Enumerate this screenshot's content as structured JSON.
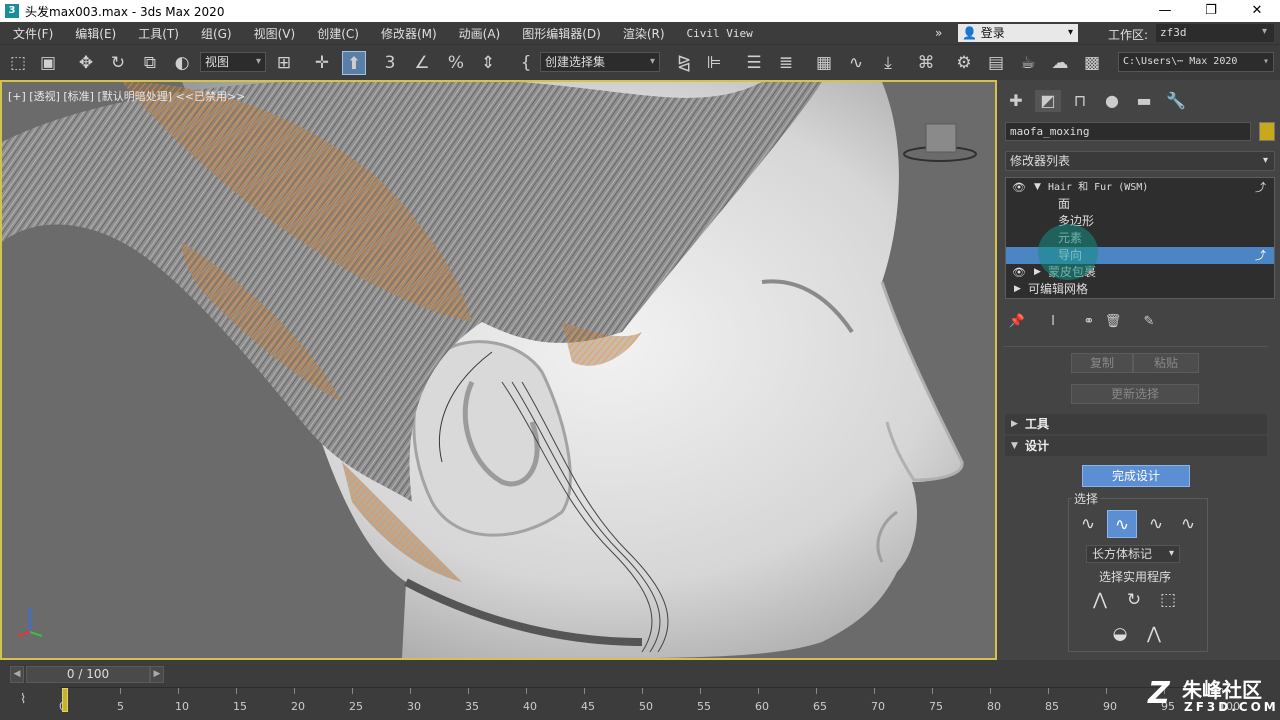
{
  "window": {
    "title": "头发max003.max - 3ds Max 2020",
    "app_icon": "3"
  },
  "menu": [
    "文件(F)",
    "编辑(E)",
    "工具(T)",
    "组(G)",
    "视图(V)",
    "创建(C)",
    "修改器(M)",
    "动画(A)",
    "图形编辑器(D)",
    "渲染(R)",
    "Civil View"
  ],
  "login": "登录",
  "workspace": {
    "label": "工作区:",
    "value": "zf3d"
  },
  "toolbar": {
    "ref_coord": "视图",
    "selection_set": "创建选择集",
    "path": "C:\\Users\\⋯ Max 2020"
  },
  "viewport": {
    "label": "[+] [透视] [标准] [默认明暗处理]   <<已禁用>>"
  },
  "command_panel": {
    "object_name": "maofa_moxing",
    "object_color": "#c8a91c",
    "modifier_list": "修改器列表",
    "stack": [
      {
        "label": "Hair 和 Fur (WSM)",
        "level": 0,
        "expanded": true,
        "selected": false
      },
      {
        "label": "面",
        "level": 1,
        "selected": false
      },
      {
        "label": "多边形",
        "level": 1,
        "selected": false
      },
      {
        "label": "元素",
        "level": 1,
        "selected": false
      },
      {
        "label": "导向",
        "level": 1,
        "selected": true
      },
      {
        "label": "蒙皮包裹",
        "level": 0,
        "expanded": false,
        "selected": false
      },
      {
        "label": "可编辑网格",
        "level": 0,
        "expanded": false,
        "selected": false
      }
    ],
    "copy_label": "复制",
    "paste_label": "粘贴",
    "update_selection": "更新选择",
    "tools_rollout": "工具",
    "design_rollout": "设计",
    "finish_design": "完成设计",
    "selection_group": "选择",
    "box_marker": "长方体标记",
    "selection_utilities": "选择实用程序"
  },
  "timeline": {
    "frame_counter": "0 / 100",
    "ticks": [
      "0",
      "5",
      "10",
      "15",
      "20",
      "25",
      "30",
      "35",
      "40",
      "45",
      "50",
      "55",
      "60",
      "65",
      "70",
      "75",
      "80",
      "85",
      "90",
      "95",
      "100"
    ]
  },
  "watermark": {
    "brand": "朱峰社区",
    "url": "ZF3D.COM"
  }
}
